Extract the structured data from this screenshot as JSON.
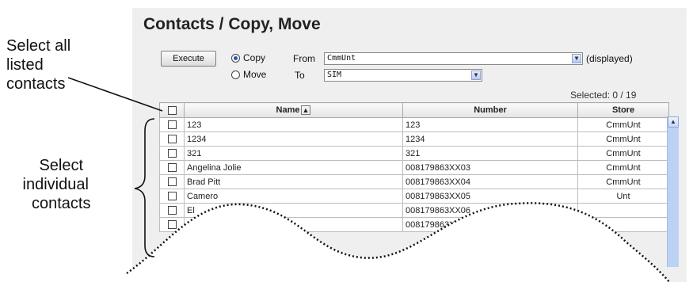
{
  "title": "Contacts / Copy, Move",
  "execute_label": "Execute",
  "copy_label": "Copy",
  "move_label": "Move",
  "from_label": "From",
  "to_label": "To",
  "from_value": "CmmUnt",
  "to_value": "SIM",
  "displayed_note": "(displayed)",
  "selected_text": "Selected:  0  / 19",
  "columns": {
    "name": "Name",
    "number": "Number",
    "store": "Store"
  },
  "rows": [
    {
      "name": "123",
      "number": "123",
      "store": "CmmUnt"
    },
    {
      "name": "1234",
      "number": "1234",
      "store": "CmmUnt"
    },
    {
      "name": "321",
      "number": "321",
      "store": "CmmUnt"
    },
    {
      "name": "Angelina Jolie",
      "number": "008179863XX03",
      "store": "CmmUnt"
    },
    {
      "name": "Brad Pitt",
      "number": "008179863XX04",
      "store": "CmmUnt"
    },
    {
      "name": "Camero",
      "number": "008179863XX05",
      "store": "Unt"
    },
    {
      "name": "El",
      "number": "008179863XX06",
      "store": ""
    },
    {
      "name": "",
      "number": "008179863XX",
      "store": ""
    }
  ],
  "annotations": {
    "select_all": [
      "Select all",
      "listed",
      "contacts"
    ],
    "select_individual": [
      "Select",
      "individual",
      "contacts"
    ]
  },
  "icons": {
    "sort": "sort-up-icon",
    "dropdown": "chevron-down-icon",
    "scroll_up": "scroll-up-arrow-icon"
  }
}
